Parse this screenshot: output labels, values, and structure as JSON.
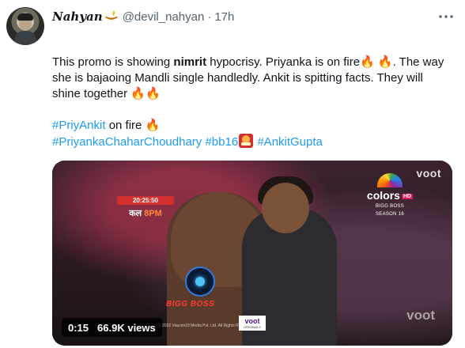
{
  "tweet": {
    "author": {
      "display_name": "Nahyan",
      "handle": "@devil_nahyan",
      "separator": "·",
      "time": "17h"
    },
    "body": {
      "line1_before": "This promo is showing ",
      "line1_bold": "nimrit",
      "line1_after": " hypocrisy. Priyanka is on fire",
      "line1_end": ". The way",
      "line2": "she is bajaoing Mandli single handledly. Ankit is spitting facts. They will",
      "line3": "shine together ",
      "fire": "🔥",
      "hashtag1": "#PriyAnkit",
      "hashtag1_after": " on fire ",
      "hashtag2": "#PriyankaChaharChoudhary",
      "hashtag3": "#bb16",
      "hashtag4": "#AnkitGupta"
    },
    "video": {
      "duration": "0:15",
      "views": "66.9K views",
      "overlay": {
        "voot_top": "voot",
        "channel": "colors",
        "channel_hd": "HD",
        "show_line1": "BIGG BOSS",
        "show_line2": "SEASON 16",
        "clock": "20:25:50",
        "slot_prefix": "कल ",
        "slot_time": "8PM",
        "show_logo": "BIGG BOSS",
        "copyright": "© 2022 Viacom18 Media Pvt. Ltd. All Rights Reserved",
        "voot_bottom": "voot",
        "voot_bottom_sub": "ORIGINALS",
        "voot_corner": "voot"
      }
    }
  }
}
